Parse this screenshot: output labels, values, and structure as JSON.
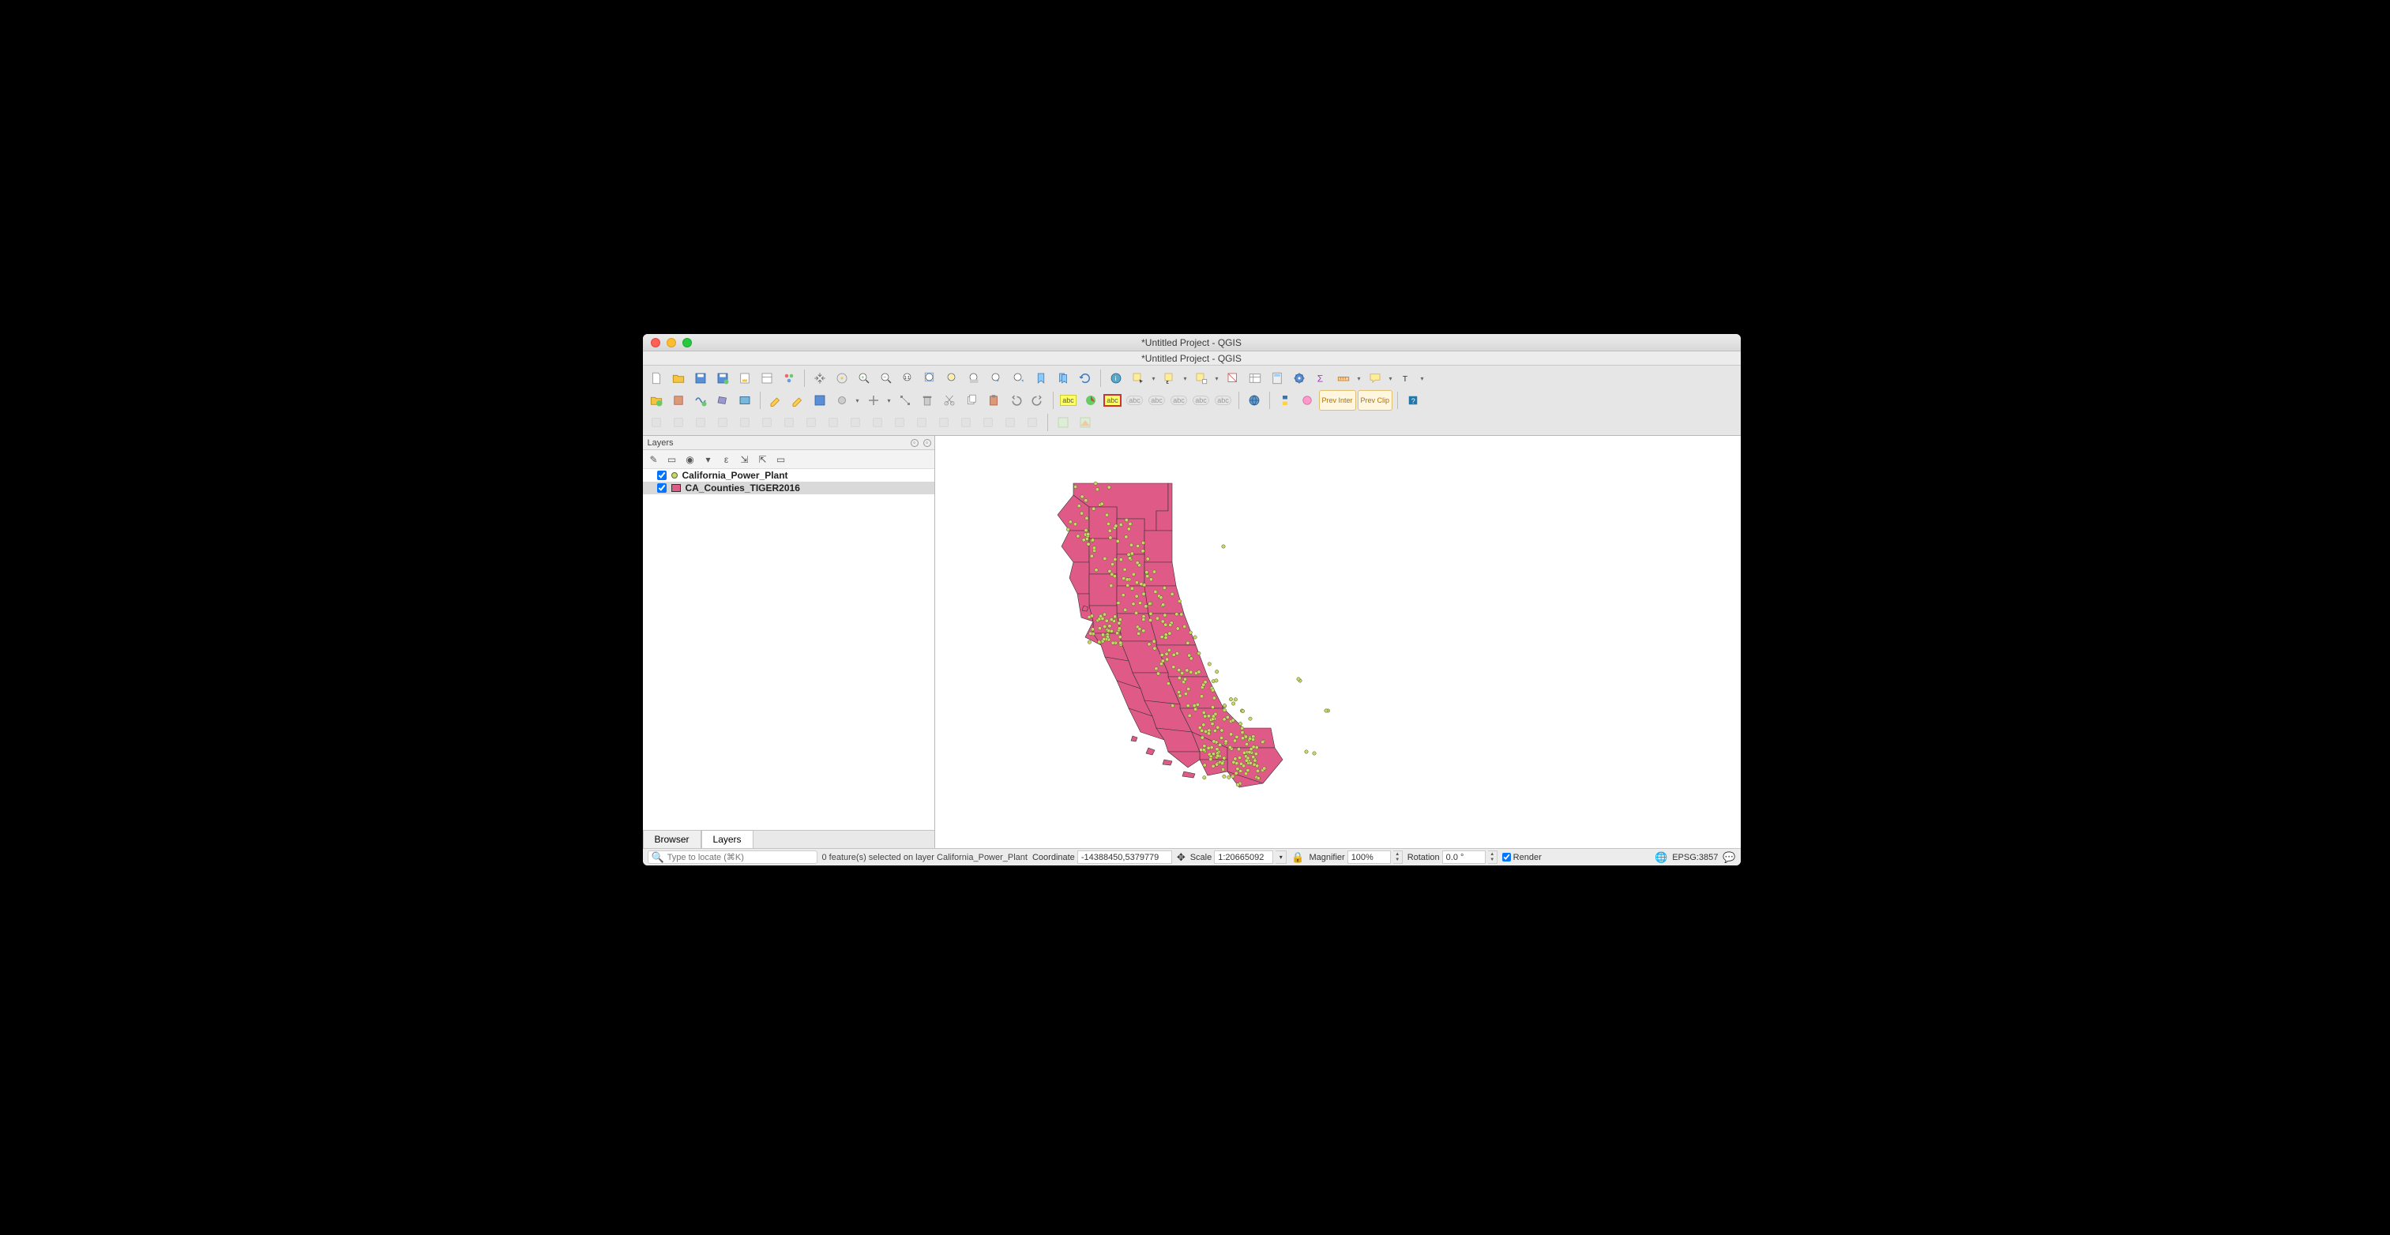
{
  "window": {
    "title": "*Untitled Project - QGIS",
    "subtitle": "*Untitled Project - QGIS"
  },
  "panels": {
    "layers_title": "Layers",
    "tabs": {
      "browser": "Browser",
      "layers": "Layers"
    }
  },
  "layers": [
    {
      "name": "California_Power_Plant",
      "checked": true,
      "type": "point",
      "selected": false
    },
    {
      "name": "CA_Counties_TIGER2016",
      "checked": true,
      "type": "polygon",
      "selected": true
    }
  ],
  "status": {
    "locate_placeholder": "Type to locate (⌘K)",
    "selection_msg": "0 feature(s) selected on layer California_Power_Plant",
    "coordinate_label": "Coordinate",
    "coordinate_value": "-14388450,5379779",
    "scale_label": "Scale",
    "scale_value": "1:20665092",
    "magnifier_label": "Magnifier",
    "magnifier_value": "100%",
    "rotation_label": "Rotation",
    "rotation_value": "0.0 °",
    "render_label": "Render",
    "crs": "EPSG:3857"
  },
  "colors": {
    "polygon_fill": "#e05a87",
    "point_fill": "#c8d66a"
  },
  "toolbar_icons": {
    "row1": [
      "new-project",
      "open-project",
      "save-project",
      "save-as-project",
      "new-print-layout",
      "show-layout-manager",
      "style-manager",
      "|",
      "pan",
      "pan-to-selection",
      "zoom-in",
      "zoom-out",
      "zoom-native",
      "zoom-full",
      "zoom-to-selection",
      "zoom-to-layer",
      "zoom-last",
      "zoom-next",
      "new-bookmark",
      "show-bookmarks",
      "refresh",
      "|",
      "identify",
      "select-features",
      "v",
      "select-by-expression",
      "v",
      "select-by-value",
      "v",
      "deselect-all",
      "open-attribute-table",
      "open-field-calculator",
      "toolbox",
      "statistics",
      "measure",
      "v",
      "show-map-tips",
      "v",
      "annotation",
      "v"
    ],
    "row2": [
      "open-data-source-manager",
      "new-geopackage",
      "new-shapefile",
      "new-spatialite",
      "new-virtual-layer",
      "|",
      "current-edits",
      "toggle-editing",
      "save-edits",
      "add-feature",
      "v",
      "move-feature",
      "v",
      "node-tool",
      "delete-selected",
      "cut",
      "copy",
      "paste",
      "undo",
      "redo",
      "|",
      "abc-single",
      "diagram",
      "abc-boxed",
      "abc-r1",
      "abc-r2",
      "abc-r3",
      "abc-r4",
      "abc-r5",
      "|",
      "metasearch",
      "|",
      "python",
      "plugin-a",
      "prev-inter",
      "prev-clip",
      "|",
      "help"
    ],
    "row3": [
      "dig-a",
      "dig-b",
      "dig-c",
      "dig-d",
      "dig-e",
      "dig-f",
      "dig-g",
      "dig-h",
      "dig-i",
      "dig-j",
      "dig-k",
      "dig-l",
      "dig-m",
      "dig-n",
      "dig-o",
      "dig-p",
      "dig-q",
      "dig-r",
      "|",
      "georef-a",
      "georef-b"
    ]
  }
}
